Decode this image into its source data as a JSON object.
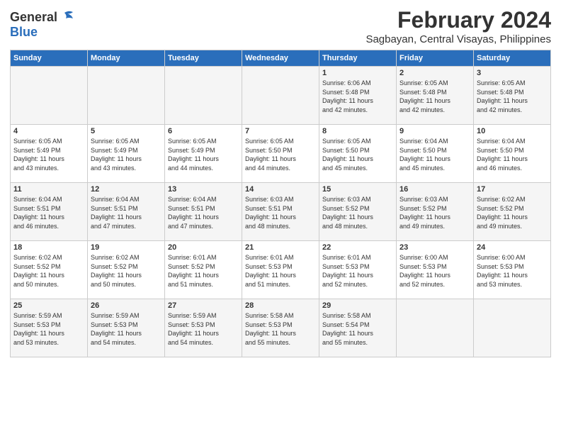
{
  "logo": {
    "general": "General",
    "blue": "Blue"
  },
  "title": "February 2024",
  "location": "Sagbayan, Central Visayas, Philippines",
  "weekdays": [
    "Sunday",
    "Monday",
    "Tuesday",
    "Wednesday",
    "Thursday",
    "Friday",
    "Saturday"
  ],
  "weeks": [
    [
      {
        "day": "",
        "info": ""
      },
      {
        "day": "",
        "info": ""
      },
      {
        "day": "",
        "info": ""
      },
      {
        "day": "",
        "info": ""
      },
      {
        "day": "1",
        "info": "Sunrise: 6:06 AM\nSunset: 5:48 PM\nDaylight: 11 hours\nand 42 minutes."
      },
      {
        "day": "2",
        "info": "Sunrise: 6:05 AM\nSunset: 5:48 PM\nDaylight: 11 hours\nand 42 minutes."
      },
      {
        "day": "3",
        "info": "Sunrise: 6:05 AM\nSunset: 5:48 PM\nDaylight: 11 hours\nand 42 minutes."
      }
    ],
    [
      {
        "day": "4",
        "info": "Sunrise: 6:05 AM\nSunset: 5:49 PM\nDaylight: 11 hours\nand 43 minutes."
      },
      {
        "day": "5",
        "info": "Sunrise: 6:05 AM\nSunset: 5:49 PM\nDaylight: 11 hours\nand 43 minutes."
      },
      {
        "day": "6",
        "info": "Sunrise: 6:05 AM\nSunset: 5:49 PM\nDaylight: 11 hours\nand 44 minutes."
      },
      {
        "day": "7",
        "info": "Sunrise: 6:05 AM\nSunset: 5:50 PM\nDaylight: 11 hours\nand 44 minutes."
      },
      {
        "day": "8",
        "info": "Sunrise: 6:05 AM\nSunset: 5:50 PM\nDaylight: 11 hours\nand 45 minutes."
      },
      {
        "day": "9",
        "info": "Sunrise: 6:04 AM\nSunset: 5:50 PM\nDaylight: 11 hours\nand 45 minutes."
      },
      {
        "day": "10",
        "info": "Sunrise: 6:04 AM\nSunset: 5:50 PM\nDaylight: 11 hours\nand 46 minutes."
      }
    ],
    [
      {
        "day": "11",
        "info": "Sunrise: 6:04 AM\nSunset: 5:51 PM\nDaylight: 11 hours\nand 46 minutes."
      },
      {
        "day": "12",
        "info": "Sunrise: 6:04 AM\nSunset: 5:51 PM\nDaylight: 11 hours\nand 47 minutes."
      },
      {
        "day": "13",
        "info": "Sunrise: 6:04 AM\nSunset: 5:51 PM\nDaylight: 11 hours\nand 47 minutes."
      },
      {
        "day": "14",
        "info": "Sunrise: 6:03 AM\nSunset: 5:51 PM\nDaylight: 11 hours\nand 48 minutes."
      },
      {
        "day": "15",
        "info": "Sunrise: 6:03 AM\nSunset: 5:52 PM\nDaylight: 11 hours\nand 48 minutes."
      },
      {
        "day": "16",
        "info": "Sunrise: 6:03 AM\nSunset: 5:52 PM\nDaylight: 11 hours\nand 49 minutes."
      },
      {
        "day": "17",
        "info": "Sunrise: 6:02 AM\nSunset: 5:52 PM\nDaylight: 11 hours\nand 49 minutes."
      }
    ],
    [
      {
        "day": "18",
        "info": "Sunrise: 6:02 AM\nSunset: 5:52 PM\nDaylight: 11 hours\nand 50 minutes."
      },
      {
        "day": "19",
        "info": "Sunrise: 6:02 AM\nSunset: 5:52 PM\nDaylight: 11 hours\nand 50 minutes."
      },
      {
        "day": "20",
        "info": "Sunrise: 6:01 AM\nSunset: 5:52 PM\nDaylight: 11 hours\nand 51 minutes."
      },
      {
        "day": "21",
        "info": "Sunrise: 6:01 AM\nSunset: 5:53 PM\nDaylight: 11 hours\nand 51 minutes."
      },
      {
        "day": "22",
        "info": "Sunrise: 6:01 AM\nSunset: 5:53 PM\nDaylight: 11 hours\nand 52 minutes."
      },
      {
        "day": "23",
        "info": "Sunrise: 6:00 AM\nSunset: 5:53 PM\nDaylight: 11 hours\nand 52 minutes."
      },
      {
        "day": "24",
        "info": "Sunrise: 6:00 AM\nSunset: 5:53 PM\nDaylight: 11 hours\nand 53 minutes."
      }
    ],
    [
      {
        "day": "25",
        "info": "Sunrise: 5:59 AM\nSunset: 5:53 PM\nDaylight: 11 hours\nand 53 minutes."
      },
      {
        "day": "26",
        "info": "Sunrise: 5:59 AM\nSunset: 5:53 PM\nDaylight: 11 hours\nand 54 minutes."
      },
      {
        "day": "27",
        "info": "Sunrise: 5:59 AM\nSunset: 5:53 PM\nDaylight: 11 hours\nand 54 minutes."
      },
      {
        "day": "28",
        "info": "Sunrise: 5:58 AM\nSunset: 5:53 PM\nDaylight: 11 hours\nand 55 minutes."
      },
      {
        "day": "29",
        "info": "Sunrise: 5:58 AM\nSunset: 5:54 PM\nDaylight: 11 hours\nand 55 minutes."
      },
      {
        "day": "",
        "info": ""
      },
      {
        "day": "",
        "info": ""
      }
    ]
  ]
}
